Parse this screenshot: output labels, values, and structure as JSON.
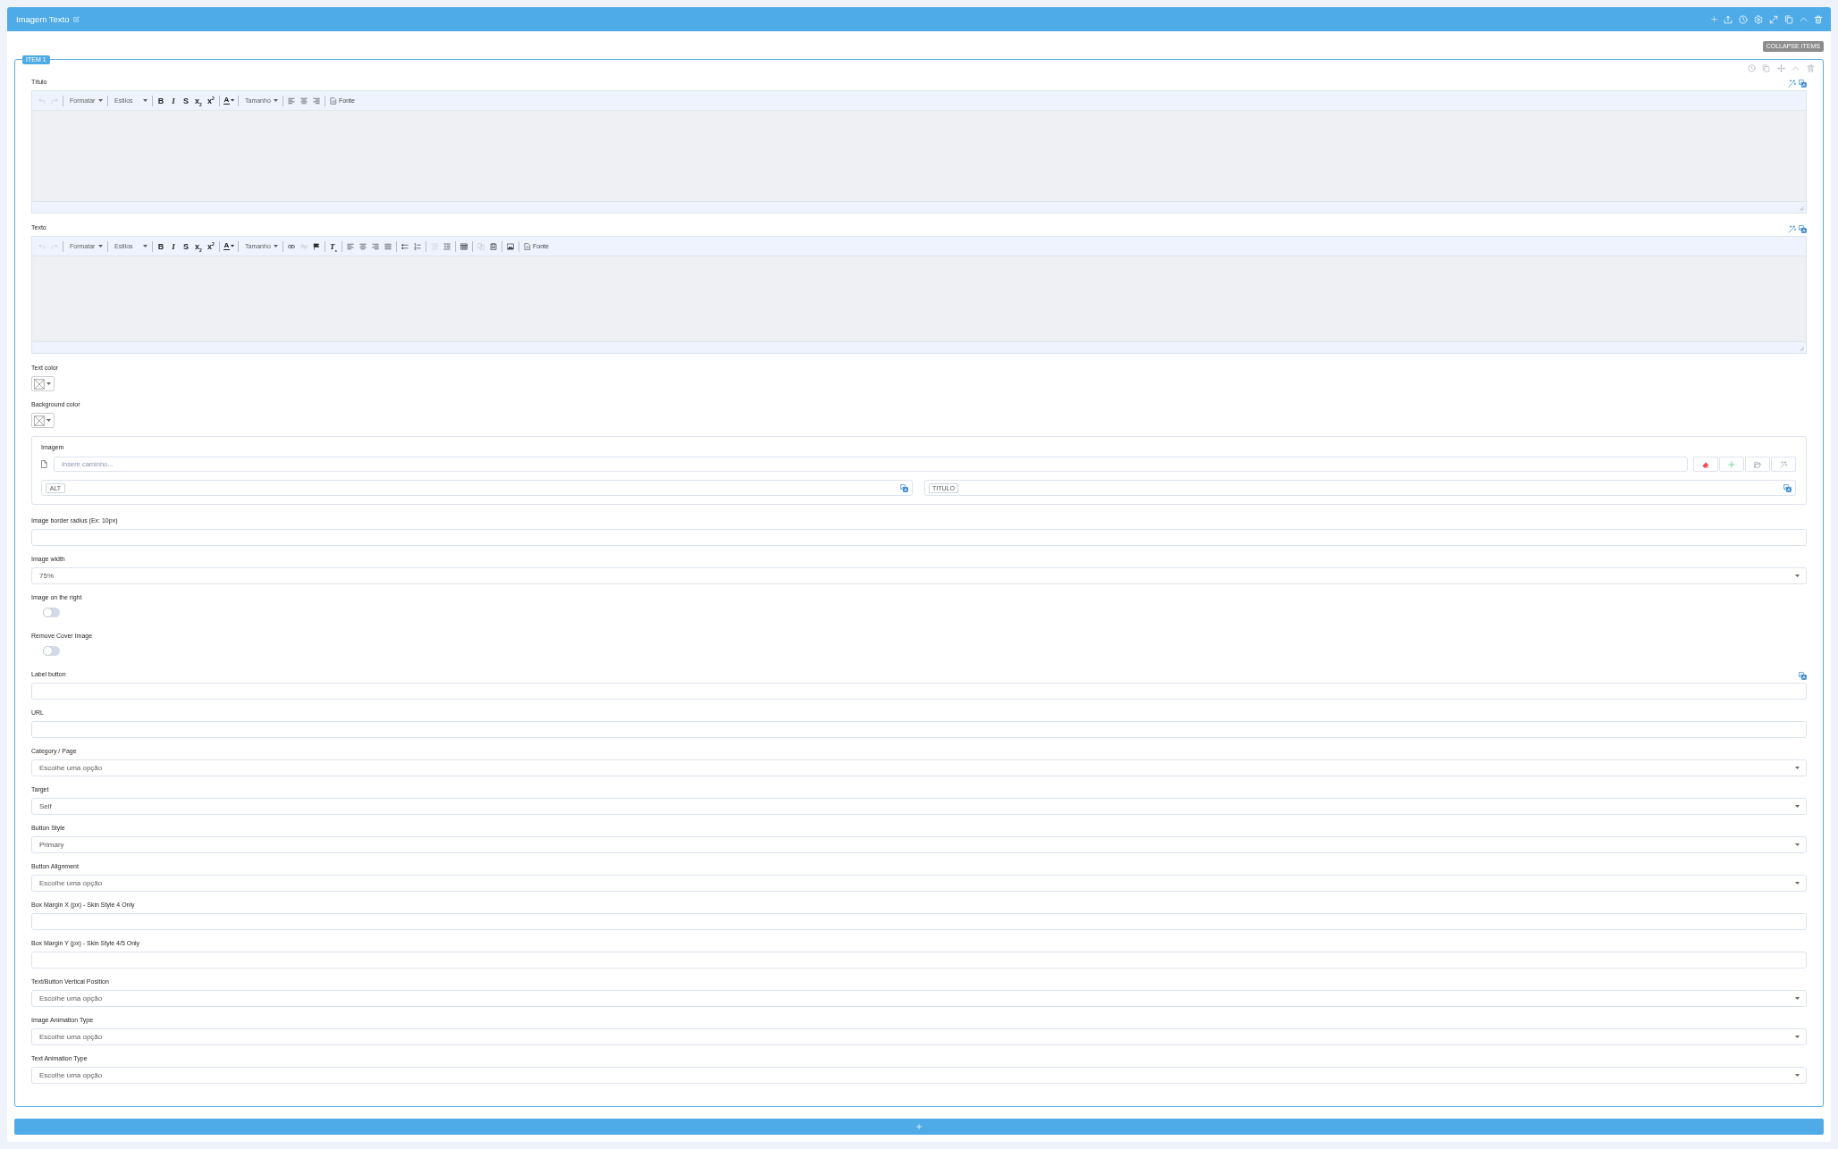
{
  "panel": {
    "title": "Imagem Texto",
    "collapse_button": "COLLAPSE ITEMS",
    "item": {
      "badge": "ITEM 1",
      "fields": [
        {
          "kind": "editor",
          "label": "Título",
          "translatable": true,
          "toolbar": [
            [
              {
                "kind": "undo",
                "disabled": true
              },
              {
                "kind": "redo",
                "disabled": true
              }
            ],
            [
              {
                "kind": "dropdown",
                "label": "Formatar",
                "disabled": false
              }
            ],
            [
              {
                "kind": "dropdown",
                "label": "Estilos",
                "disabled": false
              }
            ],
            [
              {
                "kind": "bold",
                "label": "B",
                "disabled": false
              },
              {
                "kind": "italic",
                "label": "I",
                "disabled": false
              },
              {
                "kind": "strike",
                "label": "S",
                "disabled": false
              },
              {
                "kind": "subscript",
                "label": "x$_{2}$",
                "disabled": false
              },
              {
                "kind": "superscript",
                "label": "x$^{2}$",
                "disabled": false
              }
            ],
            [
              {
                "kind": "textcolor",
                "label": "A",
                "disabled": false
              }
            ],
            [
              {
                "kind": "dropdown",
                "label": "Tamanho",
                "disabled": false
              }
            ],
            [
              {
                "kind": "align-left",
                "disabled": false
              },
              {
                "kind": "align-center",
                "disabled": false
              },
              {
                "kind": "align-right",
                "disabled": false
              }
            ],
            [
              {
                "kind": "source",
                "label": "Fonte",
                "disabled": false
              }
            ]
          ]
        },
        {
          "kind": "editor",
          "label": "Texto",
          "translatable": true,
          "toolbar": [
            [
              {
                "kind": "undo",
                "disabled": true
              },
              {
                "kind": "redo",
                "disabled": true
              }
            ],
            [
              {
                "kind": "dropdown",
                "label": "Formatar",
                "disabled": false
              }
            ],
            [
              {
                "kind": "dropdown",
                "label": "Estilos",
                "disabled": false
              }
            ],
            [
              {
                "kind": "bold",
                "label": "B",
                "disabled": false
              },
              {
                "kind": "italic",
                "label": "I",
                "disabled": false
              },
              {
                "kind": "strike",
                "label": "S",
                "disabled": false
              },
              {
                "kind": "subscript",
                "label": "x$_{2}$",
                "disabled": false
              },
              {
                "kind": "superscript",
                "label": "x$^{2}$",
                "disabled": false
              }
            ],
            [
              {
                "kind": "textcolor",
                "label": "A",
                "disabled": false
              }
            ],
            [
              {
                "kind": "dropdown",
                "label": "Tamanho",
                "disabled": false
              }
            ],
            [
              {
                "kind": "link",
                "disabled": false
              },
              {
                "kind": "unlink",
                "disabled": true
              },
              {
                "kind": "anchor",
                "disabled": false
              }
            ],
            [
              {
                "kind": "clear",
                "label": "T$_{x}$",
                "disabled": false
              }
            ],
            [
              {
                "kind": "align-left",
                "disabled": false
              },
              {
                "kind": "align-center",
                "disabled": false
              },
              {
                "kind": "align-right",
                "disabled": false
              },
              {
                "kind": "align-justify",
                "disabled": false
              }
            ],
            [
              {
                "kind": "bullets",
                "disabled": false
              },
              {
                "kind": "numbers",
                "disabled": false
              }
            ],
            [
              {
                "kind": "outdent",
                "disabled": true
              },
              {
                "kind": "indent",
                "disabled": false
              }
            ],
            [
              {
                "kind": "table",
                "disabled": false
              }
            ],
            [
              {
                "kind": "copy",
                "disabled": true
              },
              {
                "kind": "paste",
                "disabled": false
              }
            ],
            [
              {
                "kind": "image",
                "disabled": false
              }
            ],
            [
              {
                "kind": "source",
                "label": "Fonte",
                "disabled": false
              }
            ]
          ]
        },
        {
          "kind": "color",
          "label": "Text color",
          "translatable": false
        },
        {
          "kind": "color",
          "label": "Background color",
          "translatable": false
        },
        {
          "kind": "image",
          "label": "Imagem",
          "translatable": false,
          "placeholder": "Inserir caminho...",
          "inputs": [
            {
              "label": "ALT",
              "translatable": true
            },
            {
              "label": "TITULO",
              "translatable": true
            }
          ]
        },
        {
          "kind": "text",
          "label": "Image border radius (Ex: 10px)",
          "translatable": false
        },
        {
          "kind": "select",
          "label": "Image width",
          "translatable": false,
          "value": "75%"
        },
        {
          "kind": "toggle",
          "label": "Image on the right",
          "translatable": false,
          "on": false
        },
        {
          "kind": "toggle",
          "label": "Remove Cover Image",
          "translatable": false,
          "on": false
        },
        {
          "kind": "text",
          "label": "Label button",
          "translatable": true
        },
        {
          "kind": "text",
          "label": "URL",
          "translatable": false
        },
        {
          "kind": "select",
          "label": "Category / Page",
          "translatable": false,
          "placeholder": "Escolhe uma opção"
        },
        {
          "kind": "select",
          "label": "Target",
          "translatable": false,
          "value": "Self"
        },
        {
          "kind": "select",
          "label": "Button Style",
          "translatable": false,
          "value": "Primary"
        },
        {
          "kind": "select",
          "label": "Button Alignment",
          "translatable": false,
          "placeholder": "Escolhe uma opção"
        },
        {
          "kind": "text",
          "label": "Box Margin X (px) - Skin Style 4 Only",
          "translatable": false
        },
        {
          "kind": "text",
          "label": "Box Margin Y (px) - Skin Style 4/5 Only",
          "translatable": false
        },
        {
          "kind": "select",
          "label": "Text/Button Vertical Position",
          "translatable": false,
          "placeholder": "Escolhe uma opção"
        },
        {
          "kind": "select",
          "label": "Image Animation Type",
          "translatable": false,
          "placeholder": "Escolhe uma opção"
        },
        {
          "kind": "select",
          "label": "Text Animation Type",
          "translatable": false,
          "placeholder": "Escolhe uma opção"
        }
      ]
    }
  }
}
